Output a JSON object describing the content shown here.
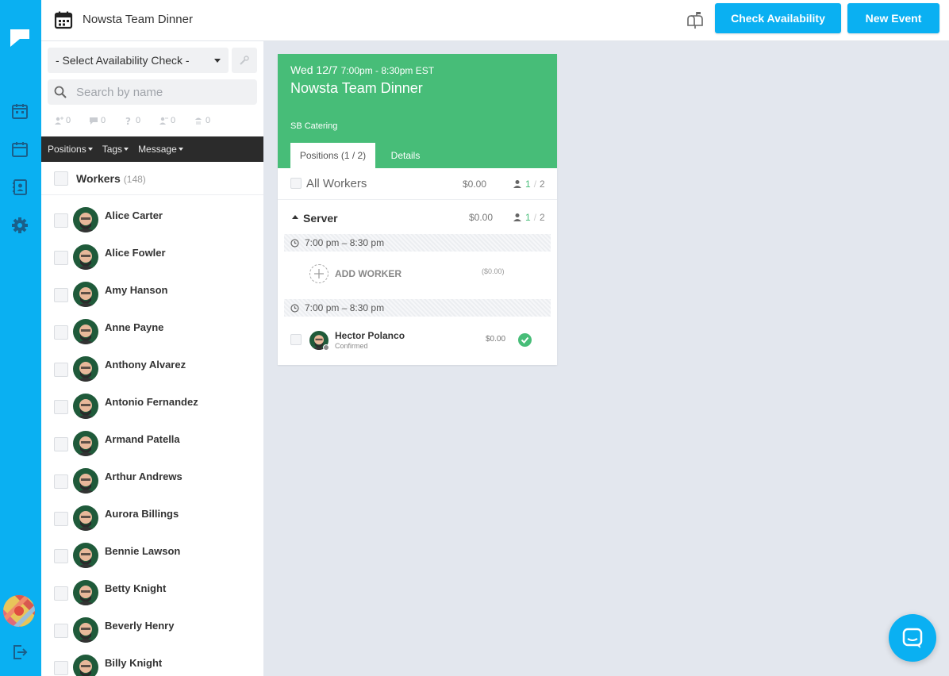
{
  "topbar": {
    "title": "Nowsta Team Dinner",
    "check_availability_label": "Check Availability",
    "new_event_label": "New Event"
  },
  "colors": {
    "brand_blue": "#0ab0f2",
    "event_green": "#47bd78",
    "toolbar_dark": "#2b2b2b"
  },
  "panel": {
    "availability_select": "- Select Availability Check -",
    "search_placeholder": "Search by name",
    "filters": [
      {
        "icon": "person-plus-icon",
        "count": "0"
      },
      {
        "icon": "chat-icon",
        "count": "0"
      },
      {
        "icon": "question-icon",
        "count": "0"
      },
      {
        "icon": "person-minus-icon",
        "count": "0"
      },
      {
        "icon": "shower-icon",
        "count": "0"
      }
    ],
    "toolbar": {
      "positions": "Positions",
      "tags": "Tags",
      "message": "Message"
    },
    "workers_label": "Workers",
    "workers_count": "(148)",
    "workers": [
      "Alice Carter",
      "Alice Fowler",
      "Amy Hanson",
      "Anne Payne",
      "Anthony Alvarez",
      "Antonio Fernandez",
      "Armand Patella",
      "Arthur Andrews",
      "Aurora Billings",
      "Bennie Lawson",
      "Betty Knight",
      "Beverly Henry",
      "Billy Knight"
    ]
  },
  "event": {
    "date": "Wed 12/7",
    "time": "7:00pm - 8:30pm EST",
    "name": "Nowsta Team Dinner",
    "venue": "SB Catering",
    "tabs": {
      "positions": "Positions (1 / 2)",
      "details": "Details"
    },
    "all_workers": {
      "label": "All Workers",
      "amount": "$0.00",
      "filled": "1",
      "separator": "/",
      "total": "2"
    },
    "server": {
      "label": "Server",
      "amount": "$0.00",
      "filled": "1",
      "separator": "/",
      "total": "2"
    },
    "shifts": [
      {
        "time": "7:00 pm – 8:30 pm"
      },
      {
        "time": "7:00 pm – 8:30 pm"
      }
    ],
    "add_worker": {
      "label": "ADD WORKER",
      "amount": "($0.00)"
    },
    "assigned_worker": {
      "name": "Hector Polanco",
      "status": "Confirmed",
      "amount": "$0.00"
    }
  }
}
